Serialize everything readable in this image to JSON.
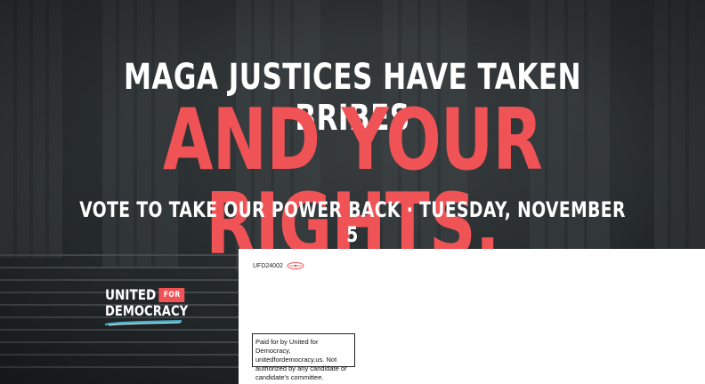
{
  "headline": {
    "line1": "MAGA JUSTICES HAVE TAKEN BRIBES",
    "line2": "AND YOUR RIGHTS.",
    "line3": "VOTE TO TAKE OUR POWER BACK · TUESDAY, NOVEMBER 5"
  },
  "logo": {
    "word1": "UNITED",
    "flag_text": "FOR",
    "word2": "DEMOCRACY"
  },
  "mail_panel": {
    "code": "UFD24002"
  },
  "disclaimer": {
    "text": "Paid for by United for Democracy, unitedfordemocracy.us. Not authorized by any candidate or candidate's committee."
  },
  "colors": {
    "accent_red": "#f05356",
    "background_dark": "#2a2e30",
    "panel_white": "#ffffff",
    "text_white": "#ffffff",
    "swoosh_teal": "#47b7d3"
  },
  "icons": {
    "mail_mark": "postal-indicia-mark-icon",
    "logo_swoosh": "logo-swoosh-icon"
  }
}
